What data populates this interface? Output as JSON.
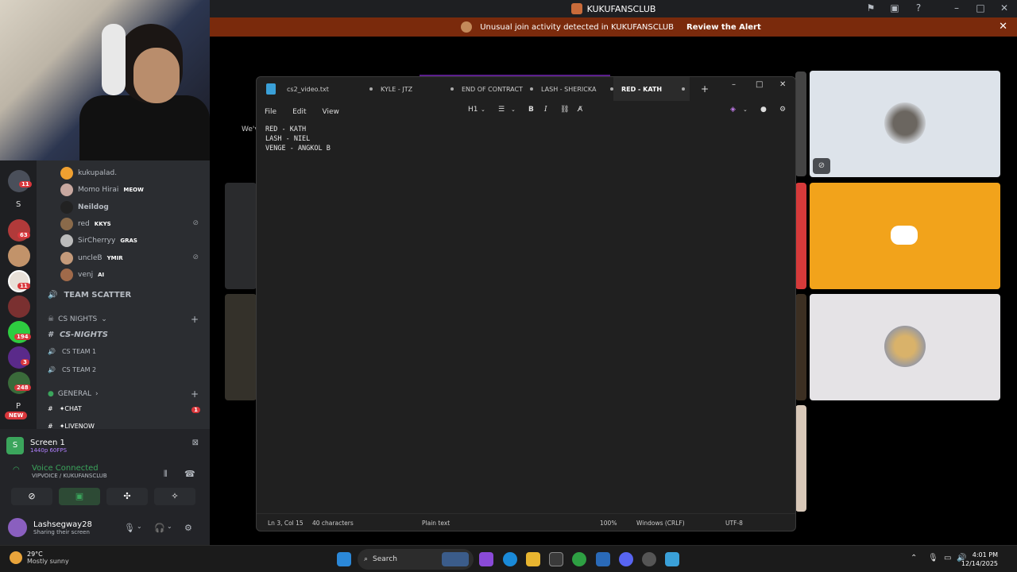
{
  "titlebar": {
    "server_name": "KUKUFANSCLUB",
    "icons": [
      "inbox-icon",
      "screen-icon",
      "help-icon",
      "minimize-icon",
      "maximize-icon",
      "close-icon"
    ]
  },
  "alert": {
    "text": "Unusual join activity detected in KUKUFANSCLUB",
    "button": "Review the Alert"
  },
  "stage": {
    "partial_text": "We'v"
  },
  "rail": {
    "letter_s": "S",
    "letter_p": "P",
    "new_badge": "NEW",
    "badges": [
      "11",
      "63",
      "11",
      "194",
      "3",
      "248"
    ]
  },
  "voice_users": [
    {
      "name": "kukupalad.",
      "tag": ""
    },
    {
      "name": "Momo Hirai",
      "tag": "MEOW"
    },
    {
      "name": "Neildog",
      "tag": ""
    },
    {
      "name": "red",
      "tag": "KKYS"
    },
    {
      "name": "SirCherryy",
      "tag": "GRAS"
    },
    {
      "name": "uncleB",
      "tag": "YMIR"
    },
    {
      "name": "venj",
      "tag": "AI"
    }
  ],
  "channels": {
    "team_scatter": "TEAM SCATTER",
    "cs_nights_cat": "CS NIGHTS",
    "cs_nights_ch": "CS-NIGHTS",
    "cs_team1": "CS TEAM 1",
    "cs_team2": "CS TEAM 2",
    "general_cat": "GENERAL",
    "chat": "✦CHAT",
    "chat_badge": "1",
    "livenow": "✦LIVENOW"
  },
  "panel": {
    "screen_title": "Screen 1",
    "screen_sub": "1440p 60FPS",
    "voice_status": "Voice Connected",
    "voice_channel": "VIPVOICE / KUKUFANSCLUB",
    "username": "Lashsegway28",
    "user_status": "Sharing their screen"
  },
  "notepad": {
    "tabs": [
      "cs2_video.txt",
      "KYLE - JTZ",
      "END OF CONTRACT",
      "LASH - SHERICKA",
      "RED - KATH"
    ],
    "active_tab": 4,
    "menu": [
      "File",
      "Edit",
      "View"
    ],
    "heading": "H1",
    "content": "RED - KATH\nLASH - NIEL\nVENGE - ANGKOL B",
    "status": {
      "position": "Ln 3, Col 15",
      "chars": "40 characters",
      "format": "Plain text",
      "zoom": "100%",
      "eol": "Windows (CRLF)",
      "encoding": "UTF-8"
    }
  },
  "taskbar": {
    "temp": "29°C",
    "weather": "Mostly sunny",
    "search": "Search",
    "time": "4:01 PM",
    "date": "12/14/2025"
  },
  "colors": {
    "alert_bg": "#7a2a0c",
    "discord_orange": "#f2a31b",
    "tile_gray": "#dde3ea"
  }
}
